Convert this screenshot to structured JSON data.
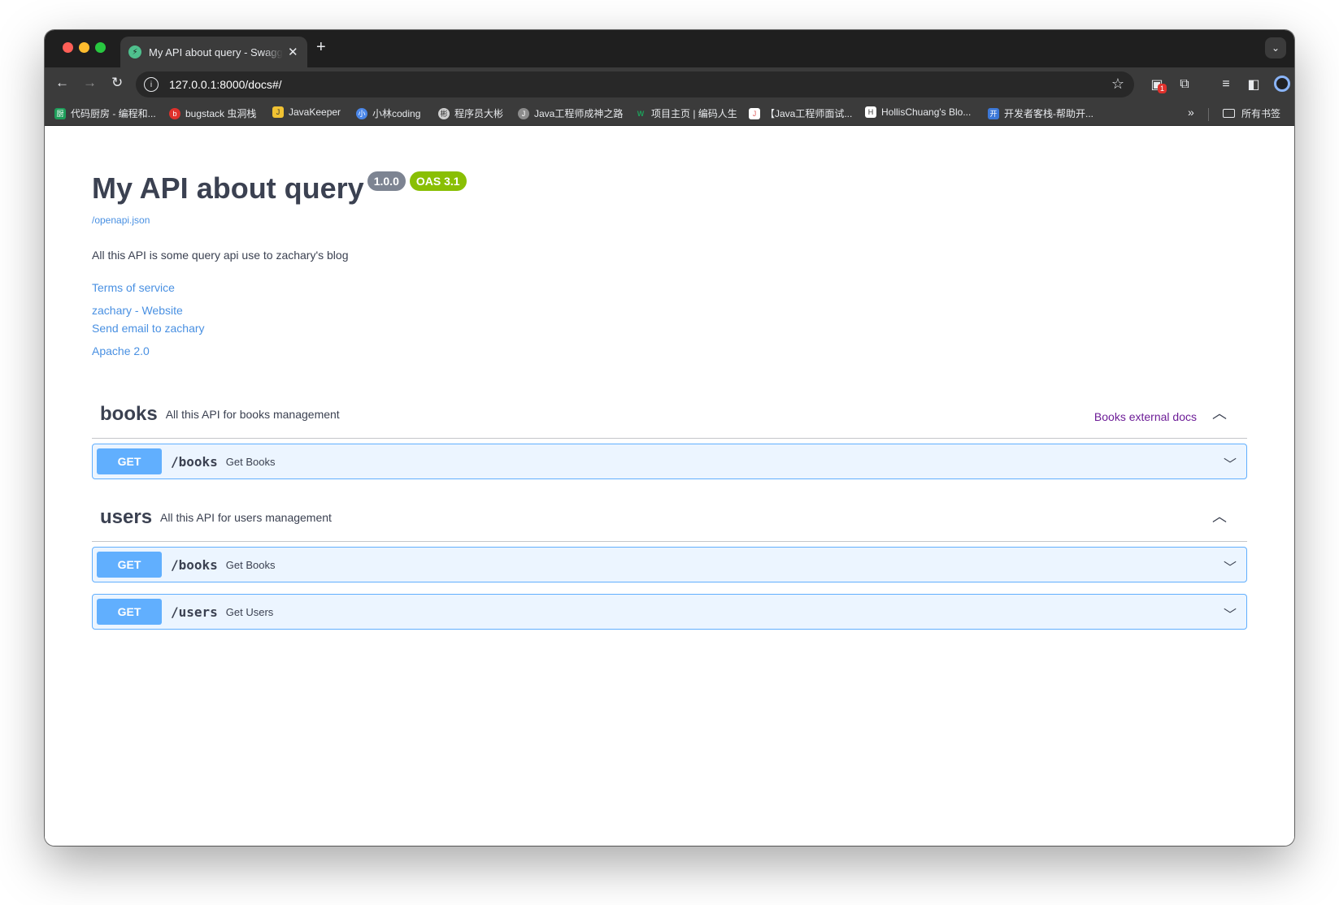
{
  "browser": {
    "tab_title": "My API about query - Swagger UI",
    "tab_close": "✕",
    "new_tab": "+",
    "url": "127.0.0.1:8000/docs#/",
    "bookmarks": [
      {
        "label": "代码厨房 - 编程和...",
        "icon_color": "#1e9e5a",
        "icon_text": "厨"
      },
      {
        "label": "bugstack 虫洞栈",
        "icon_color": "#e0312c",
        "icon_text": "b"
      },
      {
        "label": "JavaKeeper",
        "icon_color": "#f1c232",
        "icon_text": "J"
      },
      {
        "label": "小林coding",
        "icon_color": "#4a86e8",
        "icon_text": "小"
      },
      {
        "label": "程序员大彬",
        "icon_color": "#cfcfcf",
        "icon_text": "彬"
      },
      {
        "label": "Java工程师成神之路",
        "icon_color": "#8c8c8c",
        "icon_text": "J"
      },
      {
        "label": "项目主页 | 编码人生",
        "icon_color": "#1e9e5a",
        "icon_text": "W"
      },
      {
        "label": "【Java工程师面试...",
        "icon_color": "#e06666",
        "icon_text": "J"
      },
      {
        "label": "HollisChuang's Blo...",
        "icon_color": "#ffffff",
        "icon_text": "H"
      },
      {
        "label": "开发者客栈-帮助开...",
        "icon_color": "#3c78d8",
        "icon_text": "开"
      }
    ],
    "bookmarks_more": "»",
    "all_bookmarks": "所有书签",
    "extension_badge": "1"
  },
  "info": {
    "title": "My API about query",
    "version": "1.0.0",
    "oas_version": "OAS 3.1",
    "openapi_link": "/openapi.json",
    "description": "All this API is some query api use to zachary's blog",
    "terms": "Terms of service",
    "contact_website": "zachary - Website",
    "contact_email": "Send email to zachary",
    "license": "Apache 2.0"
  },
  "tags": [
    {
      "name": "books",
      "description": "All this API for books management",
      "external_docs": "Books external docs",
      "operations": [
        {
          "method": "GET",
          "path": "/books",
          "summary": "Get Books"
        }
      ]
    },
    {
      "name": "users",
      "description": "All this API for users management",
      "external_docs": "",
      "operations": [
        {
          "method": "GET",
          "path": "/books",
          "summary": "Get Books"
        },
        {
          "method": "GET",
          "path": "/users",
          "summary": "Get Users"
        }
      ]
    }
  ],
  "colors": {
    "get_accent": "#61affe",
    "version_badge": "#7d8492",
    "oas_badge": "#89bf04",
    "link": "#4990e2",
    "external_docs": "#6d1d97"
  }
}
